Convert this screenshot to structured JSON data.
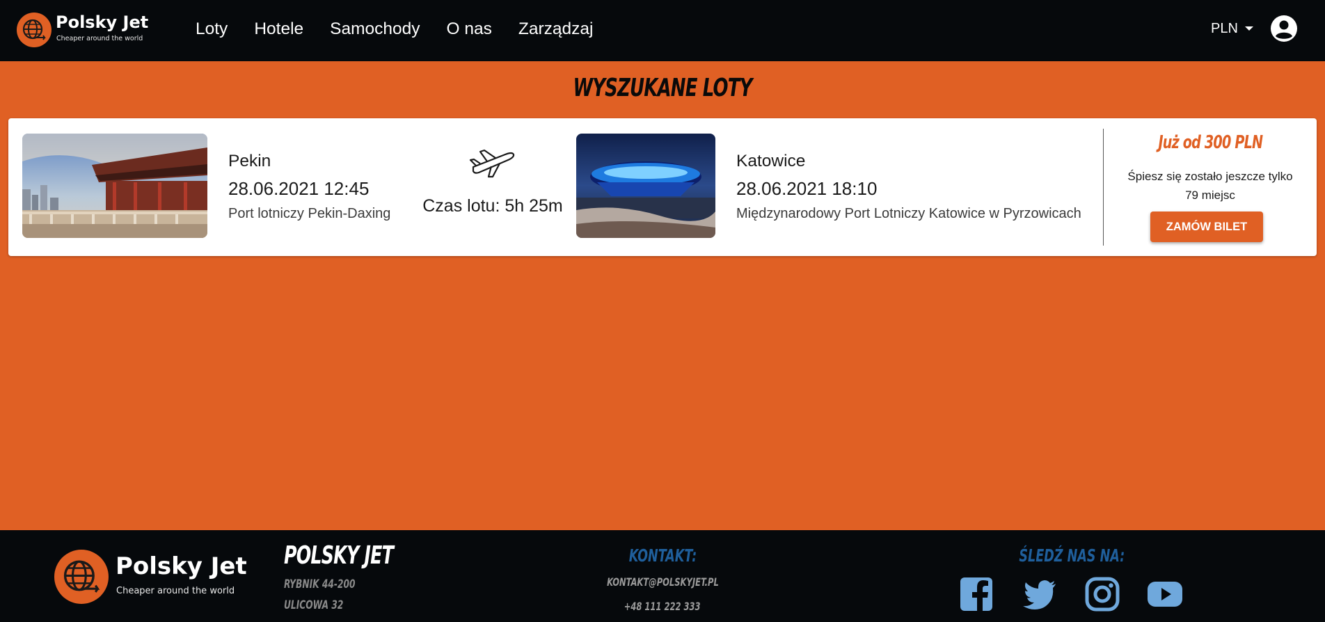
{
  "nav": {
    "brand_name": "Polsky Jet",
    "brand_tagline": "Cheaper around the world",
    "links": [
      "Loty",
      "Hotele",
      "Samochody",
      "O nas",
      "Zarządzaj"
    ],
    "currency": "PLN"
  },
  "main": {
    "title": "Wyszukane loty",
    "flight": {
      "origin": {
        "city": "Pekin",
        "datetime": "28.06.2021 12:45",
        "airport": "Port lotniczy Pekin-Daxing"
      },
      "duration": "Czas lotu: 5h 25m",
      "destination": {
        "city": "Katowice",
        "datetime": "28.06.2021 18:10",
        "airport": "Międzynarodowy Port Lotniczy Katowice w Pyrzowicach"
      },
      "price": "Już od 300 PLN",
      "seats_line1": "Śpiesz się zostało jeszcze tylko",
      "seats_line2": "79 miejsc",
      "order_label": "Zamów bilet"
    }
  },
  "footer": {
    "brand_name": "Polsky Jet",
    "brand_tagline": "Cheaper around the world",
    "company_title": "Polsky Jet",
    "address_line1": "Rybnik 44-200",
    "address_line2": "Ulicowa 32",
    "contact_heading": "Kontakt:",
    "email": "kontakt@polskyjet.pl",
    "phone": "+48 111 222 333",
    "social_heading": "Śledź nas na:",
    "social_icons": [
      "facebook-icon",
      "twitter-icon",
      "instagram-icon",
      "youtube-icon"
    ]
  },
  "colors": {
    "accent": "#e06024",
    "nav_bg": "#06090c",
    "footer_heading": "#1f5f9c",
    "social_icon": "#6fa8dc"
  }
}
